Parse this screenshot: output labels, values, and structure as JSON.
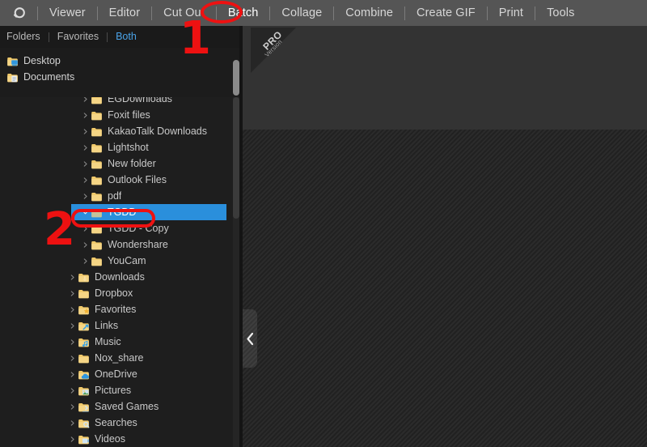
{
  "app": {
    "logo_icon": "photoscape-logo-icon",
    "accent_color": "#4aa3e8",
    "selection_color": "#2a8fdc",
    "annotation_color": "#ee1111"
  },
  "menubar": {
    "items": [
      {
        "label": "Viewer",
        "active": false
      },
      {
        "label": "Editor",
        "active": false
      },
      {
        "label": "Cut Out",
        "active": false
      },
      {
        "label": "Batch",
        "active": true
      },
      {
        "label": "Collage",
        "active": false
      },
      {
        "label": "Combine",
        "active": false
      },
      {
        "label": "Create GIF",
        "active": false
      },
      {
        "label": "Print",
        "active": false
      },
      {
        "label": "Tools",
        "active": false
      }
    ]
  },
  "sidebar": {
    "subtabs": [
      {
        "label": "Folders",
        "active": false
      },
      {
        "label": "Favorites",
        "active": false
      },
      {
        "label": "Both",
        "active": true
      }
    ],
    "roots": [
      {
        "label": "Desktop",
        "icon": "folder-desktop-icon"
      },
      {
        "label": "Documents",
        "icon": "folder-documents-icon"
      }
    ],
    "tree": [
      {
        "label": "EGDownloads",
        "icon": "folder-icon",
        "indent": 1,
        "chevron": "right",
        "selected": false
      },
      {
        "label": "Foxit files",
        "icon": "folder-icon",
        "indent": 1,
        "chevron": "right",
        "selected": false
      },
      {
        "label": "KakaoTalk Downloads",
        "icon": "folder-icon",
        "indent": 1,
        "chevron": "right",
        "selected": false
      },
      {
        "label": "Lightshot",
        "icon": "folder-icon",
        "indent": 1,
        "chevron": "right",
        "selected": false
      },
      {
        "label": "New folder",
        "icon": "folder-icon",
        "indent": 1,
        "chevron": "right",
        "selected": false
      },
      {
        "label": "Outlook Files",
        "icon": "folder-icon",
        "indent": 1,
        "chevron": "right",
        "selected": false
      },
      {
        "label": "pdf",
        "icon": "folder-icon",
        "indent": 1,
        "chevron": "right",
        "selected": false
      },
      {
        "label": "TGDD",
        "icon": "folder-icon",
        "indent": 1,
        "chevron": "down",
        "selected": true
      },
      {
        "label": "TGDD - Copy",
        "icon": "folder-icon",
        "indent": 1,
        "chevron": "right",
        "selected": false
      },
      {
        "label": "Wondershare",
        "icon": "folder-icon",
        "indent": 1,
        "chevron": "right",
        "selected": false
      },
      {
        "label": "YouCam",
        "icon": "folder-icon",
        "indent": 1,
        "chevron": "right",
        "selected": false
      },
      {
        "label": "Downloads",
        "icon": "folder-downloads-icon",
        "indent": 0,
        "chevron": "right",
        "selected": false
      },
      {
        "label": "Dropbox",
        "icon": "folder-icon",
        "indent": 0,
        "chevron": "right",
        "selected": false
      },
      {
        "label": "Favorites",
        "icon": "folder-favorites-icon",
        "indent": 0,
        "chevron": "right",
        "selected": false
      },
      {
        "label": "Links",
        "icon": "folder-links-icon",
        "indent": 0,
        "chevron": "right",
        "selected": false
      },
      {
        "label": "Music",
        "icon": "folder-music-icon",
        "indent": 0,
        "chevron": "right",
        "selected": false
      },
      {
        "label": "Nox_share",
        "icon": "folder-icon",
        "indent": 0,
        "chevron": "right",
        "selected": false
      },
      {
        "label": "OneDrive",
        "icon": "folder-onedrive-icon",
        "indent": 0,
        "chevron": "right",
        "selected": false
      },
      {
        "label": "Pictures",
        "icon": "folder-pictures-icon",
        "indent": 0,
        "chevron": "right",
        "selected": false
      },
      {
        "label": "Saved Games",
        "icon": "folder-games-icon",
        "indent": 0,
        "chevron": "right",
        "selected": false
      },
      {
        "label": "Searches",
        "icon": "folder-search-icon",
        "indent": 0,
        "chevron": "right",
        "selected": false
      },
      {
        "label": "Videos",
        "icon": "folder-videos-icon",
        "indent": 0,
        "chevron": "right",
        "selected": false
      }
    ]
  },
  "content": {
    "ribbon": {
      "title": "PRO",
      "subtitle": "Version"
    },
    "collapse_icon": "chevron-left-icon"
  },
  "annotations": [
    {
      "label": "1",
      "target": "Batch"
    },
    {
      "label": "2",
      "target": "TGDD"
    }
  ]
}
